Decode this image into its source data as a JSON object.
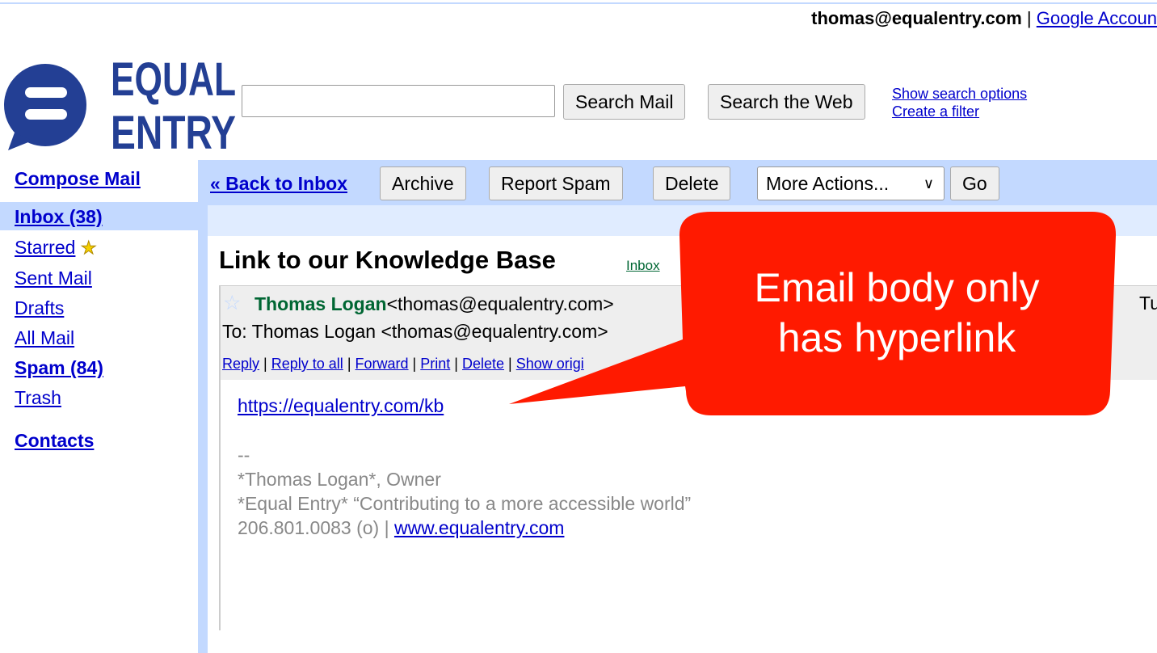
{
  "header": {
    "account_email": "thomas@equalentry.com",
    "separator": "|",
    "account_link": "Google Accoun",
    "logo_line1": "EQUAL",
    "logo_line2": "ENTRY",
    "brand_color": "#233f94"
  },
  "search": {
    "value": "",
    "placeholder": "",
    "search_mail_label": "Search Mail",
    "search_web_label": "Search the Web",
    "show_options_link": "Show search options",
    "create_filter_link": "Create a filter"
  },
  "sidebar": {
    "compose": "Compose Mail",
    "items": [
      {
        "label": "Inbox (38)",
        "bold": true,
        "selected": true
      },
      {
        "label": "Starred",
        "icon": "star-icon"
      },
      {
        "label": "Sent Mail"
      },
      {
        "label": "Drafts"
      },
      {
        "label": "All Mail"
      },
      {
        "label": "Spam (84)",
        "bold": true
      },
      {
        "label": "Trash"
      }
    ],
    "contacts": "Contacts"
  },
  "toolbar": {
    "back_link": "« Back to Inbox",
    "archive": "Archive",
    "report_spam": "Report Spam",
    "delete": "Delete",
    "more_actions": "More Actions...",
    "go": "Go"
  },
  "message": {
    "subject": "Link to our Knowledge Base",
    "label": "Inbox",
    "from_name": "Thomas Logan",
    "from_email": "<thomas@equalentry.com>",
    "to": "To: Thomas Logan <thomas@equalentry.com>",
    "date_partial": "Tu",
    "actions": [
      "Reply",
      "Reply to all",
      "Forward",
      "Print",
      "Delete",
      "Show origi"
    ],
    "body_link": "https://equalentry.com/kb",
    "signature": {
      "dashes": "--",
      "line1": "*Thomas Logan*, Owner",
      "line2": "*Equal Entry* “Contributing to a more accessible world”",
      "phone": "206.801.0083 (o) | ",
      "website": "www.equalentry.com"
    }
  },
  "annotation": {
    "line1": "Email body only",
    "line2": "has hyperlink",
    "color": "#ff1a00"
  }
}
